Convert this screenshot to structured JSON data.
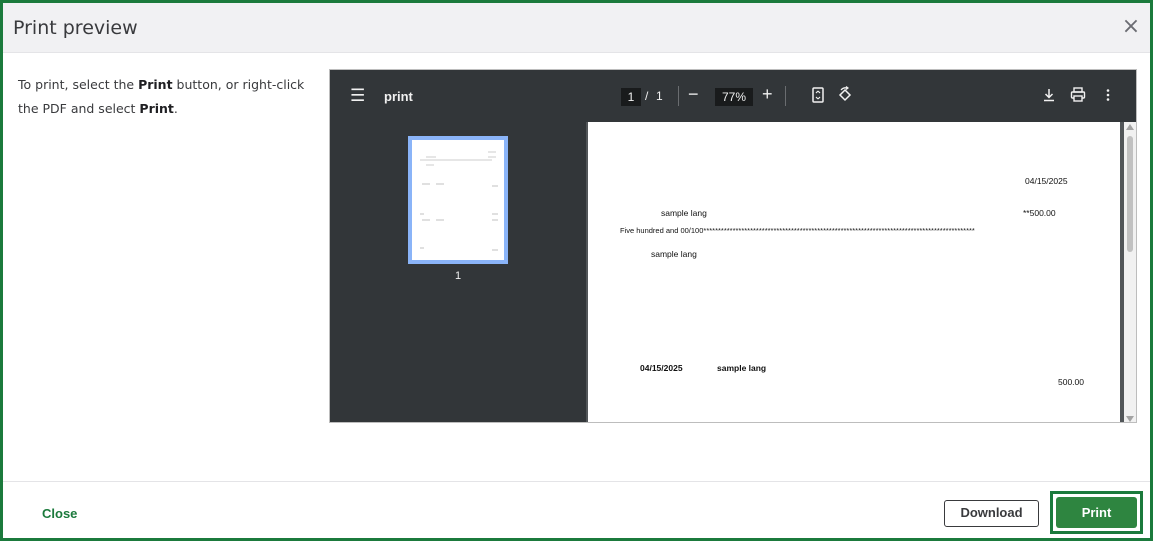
{
  "dialog": {
    "title": "Print preview",
    "close_glyph": "×"
  },
  "instructions": {
    "part1": "To print, select the ",
    "print_bold_1": "Print",
    "part2": " button, or right-click the PDF and select ",
    "print_bold_2": "Print",
    "part3": "."
  },
  "pdf_viewer": {
    "menu_icon": "☰",
    "file_name": "print",
    "current_page": "1",
    "page_separator": "/",
    "page_count": "1",
    "zoom_out": "−",
    "zoom_level": "77%",
    "zoom_in": "+",
    "thumbnail_label": "1",
    "icons": [
      "fit-page-icon",
      "rotate-icon",
      "download-icon",
      "printer-icon",
      "more-vert-icon"
    ]
  },
  "check": {
    "date_top": "04/15/2025",
    "payee": "sample lang",
    "amount": "**500.00",
    "amount_words": "Five hundred and 00/100*********************************************************************************************",
    "address_name": "sample lang",
    "stub_date": "04/15/2025",
    "stub_payee": "sample lang",
    "stub_amount": "500.00"
  },
  "footer": {
    "close_label": "Close",
    "download_label": "Download",
    "print_label": "Print"
  },
  "colors": {
    "accent_green": "#2e8540",
    "border_green": "#1b7a3c",
    "viewer_dark": "#323639"
  }
}
